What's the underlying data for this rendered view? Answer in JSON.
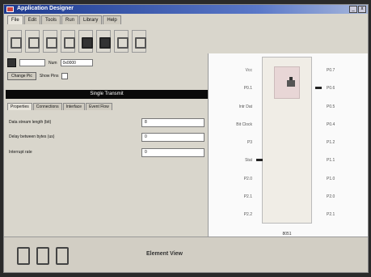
{
  "window": {
    "title": "Application Designer"
  },
  "menu_tabs": [
    "File",
    "Edit",
    "Tools",
    "Run",
    "Library",
    "Help"
  ],
  "toolbar": {
    "buttons": [
      "tool-1",
      "tool-2",
      "tool-3",
      "tool-4",
      "tool-5",
      "tool-6",
      "tool-7",
      "tool-8"
    ]
  },
  "controls": {
    "value_field": "",
    "num_label": "Num",
    "num_select": "0x0000",
    "change_pic_label": "Change Pic",
    "show_pins_label": "Show Pins"
  },
  "panel": {
    "title": "Single Transmit"
  },
  "sub_tabs": [
    "Properties",
    "Connections",
    "Interface",
    "Event Flow"
  ],
  "properties": [
    {
      "label": "Data stream length (bit)",
      "value": "8"
    },
    {
      "label": "Delay between bytes (us)",
      "value": "0"
    },
    {
      "label": "Interrupt rate",
      "value": "0"
    }
  ],
  "chip": {
    "left_pins": [
      "Vcc",
      "P0.1",
      "Intr Dat",
      "Bit Clock",
      "P3",
      "Stat",
      "P2.0",
      "P2.1",
      "P2.2"
    ],
    "right_pins": [
      "P0.7",
      "P0.6",
      "P0.5",
      "P0.4",
      "P1.2",
      "P1.1",
      "P1.0",
      "P2.0",
      "P2.1"
    ],
    "label": "8051"
  },
  "status": {
    "text": "Element View"
  }
}
